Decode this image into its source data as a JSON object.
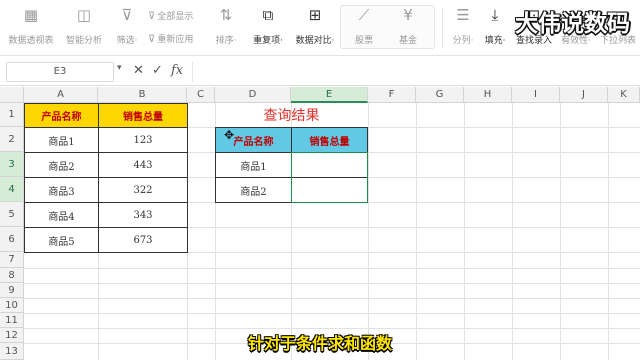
{
  "ribbon": {
    "items": [
      {
        "label": "数据透视表",
        "icon": "pivot-table-icon",
        "glyph": "▦"
      },
      {
        "label": "智能分析",
        "icon": "smart-analysis-icon",
        "glyph": "◫"
      },
      {
        "label": "筛选·",
        "icon": "filter-icon",
        "glyph": "⊽"
      },
      {
        "label": "排序·",
        "icon": "sort-icon",
        "glyph": "⇅"
      },
      {
        "label": "重复项·",
        "icon": "duplicate-icon",
        "glyph": "⧉"
      },
      {
        "label": "数据对比·",
        "icon": "data-compare-icon",
        "glyph": "⊞"
      },
      {
        "label": "股票",
        "icon": "stock-icon",
        "glyph": "⟋"
      },
      {
        "label": "基金",
        "icon": "fund-icon",
        "glyph": "¥"
      },
      {
        "label": "分列·",
        "icon": "split-column-icon",
        "glyph": "☰"
      },
      {
        "label": "填充·",
        "icon": "fill-icon",
        "glyph": "⤓"
      },
      {
        "label": "查找录入",
        "icon": "lookup-entry-icon",
        "glyph": "⊡"
      },
      {
        "label": "有效性·",
        "icon": "validation-icon",
        "glyph": "✓"
      },
      {
        "label": "下拉列表",
        "icon": "dropdown-list-icon",
        "glyph": "▾"
      }
    ],
    "small": [
      {
        "label": "全部显示",
        "icon": "show-all-icon",
        "glyph": "⊽"
      },
      {
        "label": "重新应用",
        "icon": "reapply-icon",
        "glyph": "⊽"
      }
    ]
  },
  "watermark": "大伟说数码",
  "formula_bar": {
    "name_box": "E3",
    "cancel": "✕",
    "confirm": "✓",
    "fx": "fx",
    "value": ""
  },
  "columns": [
    "A",
    "B",
    "C",
    "D",
    "E",
    "F",
    "G",
    "H",
    "I",
    "J",
    "K"
  ],
  "rows": [
    "1",
    "2",
    "3",
    "4",
    "5",
    "6",
    "7",
    "8",
    "9",
    "10",
    "11",
    "12",
    "13"
  ],
  "table1": {
    "headers": [
      "产品名称",
      "销售总量"
    ],
    "rows": [
      [
        "商品1",
        "123"
      ],
      [
        "商品2",
        "443"
      ],
      [
        "商品3",
        "322"
      ],
      [
        "商品4",
        "343"
      ],
      [
        "商品5",
        "673"
      ]
    ]
  },
  "query": {
    "title": "查询结果",
    "headers": [
      "产品名称",
      "销售总量"
    ],
    "rows": [
      [
        "商品1",
        ""
      ],
      [
        "商品2",
        ""
      ]
    ]
  },
  "subtitle": "针对于条件求和函数",
  "colors": {
    "yellow_header": "#ffd700",
    "blue_header": "#62c8e3",
    "header_text": "#c00000",
    "title_red": "#e0302a",
    "selection": "#1f8a4c"
  }
}
